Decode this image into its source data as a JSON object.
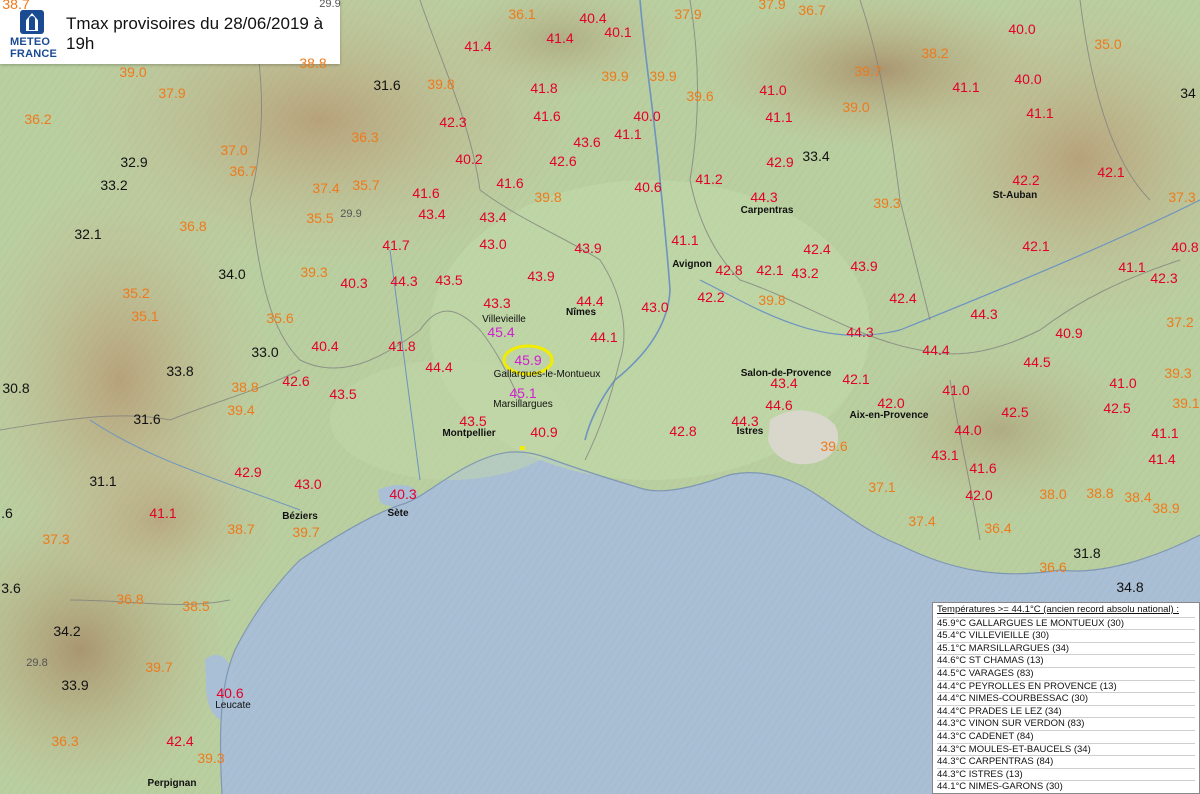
{
  "header": {
    "title": "Tmax provisoires du 28/06/2019 à 19h",
    "logo_line1": "METEO",
    "logo_line2": "FRANCE"
  },
  "colors": {
    "red": "#e3002a",
    "orange": "#ee7a1c",
    "black": "#111111",
    "magenta": "#d21ed2",
    "sea": "#a9bfd6",
    "land": "#b9cfa0",
    "relief": "#c8b48c",
    "highlight": "#f2ec00"
  },
  "temperatures": [
    {
      "v": "38.7",
      "c": "orange"
    },
    {
      "v": "29.9",
      "c": "gray"
    },
    {
      "v": "36.1",
      "c": "orange"
    },
    {
      "v": "40.4",
      "c": "red"
    },
    {
      "v": "37.9",
      "c": "orange"
    },
    {
      "v": "37.9",
      "c": "orange"
    },
    {
      "v": "36.7",
      "c": "orange"
    },
    {
      "v": "38.2",
      "c": "orange"
    },
    {
      "v": "40.0",
      "c": "red"
    },
    {
      "v": "35.0",
      "c": "orange"
    },
    {
      "v": "41.4",
      "c": "red"
    },
    {
      "v": "41.4",
      "c": "red"
    },
    {
      "v": "40.1",
      "c": "red"
    },
    {
      "v": "38.8",
      "c": "orange"
    },
    {
      "v": "39.0",
      "c": "orange"
    },
    {
      "v": "37.9",
      "c": "orange"
    },
    {
      "v": "31.6",
      "c": "black"
    },
    {
      "v": "39.8",
      "c": "orange"
    },
    {
      "v": "41.8",
      "c": "red"
    },
    {
      "v": "39.9",
      "c": "orange"
    },
    {
      "v": "39.9",
      "c": "orange"
    },
    {
      "v": "39.7",
      "c": "orange"
    },
    {
      "v": "41.1",
      "c": "red"
    },
    {
      "v": "40.0",
      "c": "red"
    },
    {
      "v": "34",
      "c": "black"
    },
    {
      "v": "36.2",
      "c": "orange"
    },
    {
      "v": "42.3",
      "c": "red"
    },
    {
      "v": "41.6",
      "c": "red"
    },
    {
      "v": "40.0",
      "c": "red"
    },
    {
      "v": "39.6",
      "c": "orange"
    },
    {
      "v": "41.0",
      "c": "red"
    },
    {
      "v": "39.0",
      "c": "orange"
    },
    {
      "v": "41.1",
      "c": "red"
    },
    {
      "v": "36.3",
      "c": "orange"
    },
    {
      "v": "43.6",
      "c": "red"
    },
    {
      "v": "41.1",
      "c": "red"
    },
    {
      "v": "41.1",
      "c": "red"
    },
    {
      "v": "37.0",
      "c": "orange"
    },
    {
      "v": "32.9",
      "c": "black"
    },
    {
      "v": "40.2",
      "c": "red"
    },
    {
      "v": "42.6",
      "c": "red"
    },
    {
      "v": "42.9",
      "c": "red"
    },
    {
      "v": "33.4",
      "c": "black"
    },
    {
      "v": "36.7",
      "c": "orange"
    },
    {
      "v": "33.2",
      "c": "black"
    },
    {
      "v": "37.4",
      "c": "orange"
    },
    {
      "v": "35.7",
      "c": "orange"
    },
    {
      "v": "41.6",
      "c": "red"
    },
    {
      "v": "41.6",
      "c": "red"
    },
    {
      "v": "41.2",
      "c": "red"
    },
    {
      "v": "42.1",
      "c": "red"
    },
    {
      "v": "42.2",
      "c": "red"
    },
    {
      "v": "40.6",
      "c": "red"
    },
    {
      "v": "39.8",
      "c": "orange"
    },
    {
      "v": "44.3",
      "c": "red"
    },
    {
      "v": "37.3",
      "c": "orange"
    },
    {
      "v": "43.4",
      "c": "red"
    },
    {
      "v": "35.5",
      "c": "orange"
    },
    {
      "v": "29.9",
      "c": "gray"
    },
    {
      "v": "43.4",
      "c": "red"
    },
    {
      "v": "39.3",
      "c": "orange"
    },
    {
      "v": "36.8",
      "c": "orange"
    },
    {
      "v": "32.1",
      "c": "black"
    },
    {
      "v": "41.7",
      "c": "red"
    },
    {
      "v": "43.0",
      "c": "red"
    },
    {
      "v": "43.9",
      "c": "red"
    },
    {
      "v": "41.1",
      "c": "red"
    },
    {
      "v": "42.4",
      "c": "red"
    },
    {
      "v": "42.1",
      "c": "red"
    },
    {
      "v": "40.8",
      "c": "red"
    },
    {
      "v": "34.0",
      "c": "black"
    },
    {
      "v": "39.3",
      "c": "orange"
    },
    {
      "v": "42.8",
      "c": "red"
    },
    {
      "v": "42.1",
      "c": "red"
    },
    {
      "v": "43.2",
      "c": "red"
    },
    {
      "v": "43.9",
      "c": "red"
    },
    {
      "v": "41.1",
      "c": "red"
    },
    {
      "v": "42.3",
      "c": "red"
    },
    {
      "v": "40.3",
      "c": "red"
    },
    {
      "v": "44.3",
      "c": "red"
    },
    {
      "v": "43.5",
      "c": "red"
    },
    {
      "v": "43.9",
      "c": "red"
    },
    {
      "v": "35.2",
      "c": "orange"
    },
    {
      "v": "42.2",
      "c": "red"
    },
    {
      "v": "39.8",
      "c": "orange"
    },
    {
      "v": "42.4",
      "c": "red"
    },
    {
      "v": "43.3",
      "c": "red"
    },
    {
      "v": "44.4",
      "c": "red"
    },
    {
      "v": "35.1",
      "c": "orange"
    },
    {
      "v": "43.0",
      "c": "red"
    },
    {
      "v": "44.3",
      "c": "red"
    },
    {
      "v": "37.2",
      "c": "orange"
    },
    {
      "v": "35.6",
      "c": "orange"
    },
    {
      "v": "44.1",
      "c": "red"
    },
    {
      "v": "44.3",
      "c": "red"
    },
    {
      "v": "40.9",
      "c": "red"
    },
    {
      "v": "40.4",
      "c": "red"
    },
    {
      "v": "41.8",
      "c": "red"
    },
    {
      "v": "33.0",
      "c": "black"
    },
    {
      "v": "44.4",
      "c": "red"
    },
    {
      "v": "44.5",
      "c": "red"
    },
    {
      "v": "39.3",
      "c": "orange"
    },
    {
      "v": "44.4",
      "c": "red"
    },
    {
      "v": "33.8",
      "c": "black"
    },
    {
      "v": "42.6",
      "c": "red"
    },
    {
      "v": "38.8",
      "c": "orange"
    },
    {
      "v": "43.4",
      "c": "red"
    },
    {
      "v": "42.1",
      "c": "red"
    },
    {
      "v": "41.0",
      "c": "red"
    },
    {
      "v": "41.0",
      "c": "red"
    },
    {
      "v": "30.8",
      "c": "black"
    },
    {
      "v": "43.5",
      "c": "red"
    },
    {
      "v": "39.4",
      "c": "orange"
    },
    {
      "v": "44.6",
      "c": "red"
    },
    {
      "v": "42.0",
      "c": "red"
    },
    {
      "v": "42.5",
      "c": "red"
    },
    {
      "v": "42.5",
      "c": "red"
    },
    {
      "v": "39.1",
      "c": "orange"
    },
    {
      "v": "31.6",
      "c": "black"
    },
    {
      "v": "43.5",
      "c": "red"
    },
    {
      "v": "40.9",
      "c": "red"
    },
    {
      "v": "42.8",
      "c": "red"
    },
    {
      "v": "44.3",
      "c": "red"
    },
    {
      "v": "39.6",
      "c": "orange"
    },
    {
      "v": "44.0",
      "c": "red"
    },
    {
      "v": "41.1",
      "c": "red"
    },
    {
      "v": "42.9",
      "c": "red"
    },
    {
      "v": "43.1",
      "c": "red"
    },
    {
      "v": "41.4",
      "c": "red"
    },
    {
      "v": "31.1",
      "c": "black"
    },
    {
      "v": "43.0",
      "c": "red"
    },
    {
      "v": "41.6",
      "c": "red"
    },
    {
      "v": "40.3",
      "c": "red"
    },
    {
      "v": "37.1",
      "c": "orange"
    },
    {
      "v": "42.0",
      "c": "red"
    },
    {
      "v": "38.0",
      "c": "orange"
    },
    {
      "v": "38.8",
      "c": "orange"
    },
    {
      "v": "38.4",
      "c": "orange"
    },
    {
      "v": ".6",
      "c": "black"
    },
    {
      "v": "41.1",
      "c": "red"
    },
    {
      "v": "38.9",
      "c": "orange"
    },
    {
      "v": "38.7",
      "c": "orange"
    },
    {
      "v": "39.7",
      "c": "orange"
    },
    {
      "v": "37.4",
      "c": "orange"
    },
    {
      "v": "37.3",
      "c": "orange"
    },
    {
      "v": "36.4",
      "c": "orange"
    },
    {
      "v": "31.8",
      "c": "black"
    },
    {
      "v": "3.6",
      "c": "black"
    },
    {
      "v": "36.6",
      "c": "orange"
    },
    {
      "v": "34.8",
      "c": "black"
    },
    {
      "v": "36.8",
      "c": "orange"
    },
    {
      "v": "38.5",
      "c": "orange"
    },
    {
      "v": "34.2",
      "c": "black"
    },
    {
      "v": "29.8",
      "c": "gray"
    },
    {
      "v": "39.7",
      "c": "orange"
    },
    {
      "v": "33.9",
      "c": "black"
    },
    {
      "v": "40.6",
      "c": "red"
    },
    {
      "v": "36.3",
      "c": "orange"
    },
    {
      "v": "42.4",
      "c": "red"
    },
    {
      "v": "39.3",
      "c": "orange"
    }
  ],
  "record_labels": [
    {
      "v": "45.4"
    },
    {
      "v": "45.9"
    },
    {
      "v": "45.1"
    }
  ],
  "cities": [
    {
      "name": "Villevieille",
      "bold": false
    },
    {
      "name": "Nîmes",
      "bold": true
    },
    {
      "name": "Avignon",
      "bold": true
    },
    {
      "name": "Carpentras",
      "bold": true
    },
    {
      "name": "St-Auban",
      "bold": true
    },
    {
      "name": "Gallargues-le-Montueux",
      "bold": false
    },
    {
      "name": "Marsillargues",
      "bold": false
    },
    {
      "name": "Montpellier",
      "bold": true
    },
    {
      "name": "Salon-de-Provence",
      "bold": true
    },
    {
      "name": "Aix-en-Provence",
      "bold": true
    },
    {
      "name": "Istres",
      "bold": true
    },
    {
      "name": "Sète",
      "bold": true
    },
    {
      "name": "Béziers",
      "bold": true
    },
    {
      "name": "Leucate",
      "bold": false
    },
    {
      "name": "Perpignan",
      "bold": true
    }
  ],
  "legend": {
    "title": "Températures >= 44.1°C (ancien record absolu national) :",
    "rows": [
      "45.9°C GALLARGUES LE MONTUEUX (30)",
      "45.4°C VILLEVIEILLE (30)",
      "45.1°C MARSILLARGUES (34)",
      "44.6°C  ST CHAMAS (13)",
      "44.5°C  VARAGES (83)",
      "44.4°C  PEYROLLES EN PROVENCE (13)",
      "44.4°C  NIMES-COURBESSAC (30)",
      "44.4°C  PRADES LE LEZ (34)",
      "44.3°C  VINON SUR VERDON (83)",
      "44.3°C  CADENET (84)",
      "44.3°C  MOULES-ET-BAUCELS (34)",
      "44.3°C  CARPENTRAS (84)",
      "44.3°C  ISTRES (13)",
      "44.1°C  NIMES-GARONS (30)"
    ]
  }
}
